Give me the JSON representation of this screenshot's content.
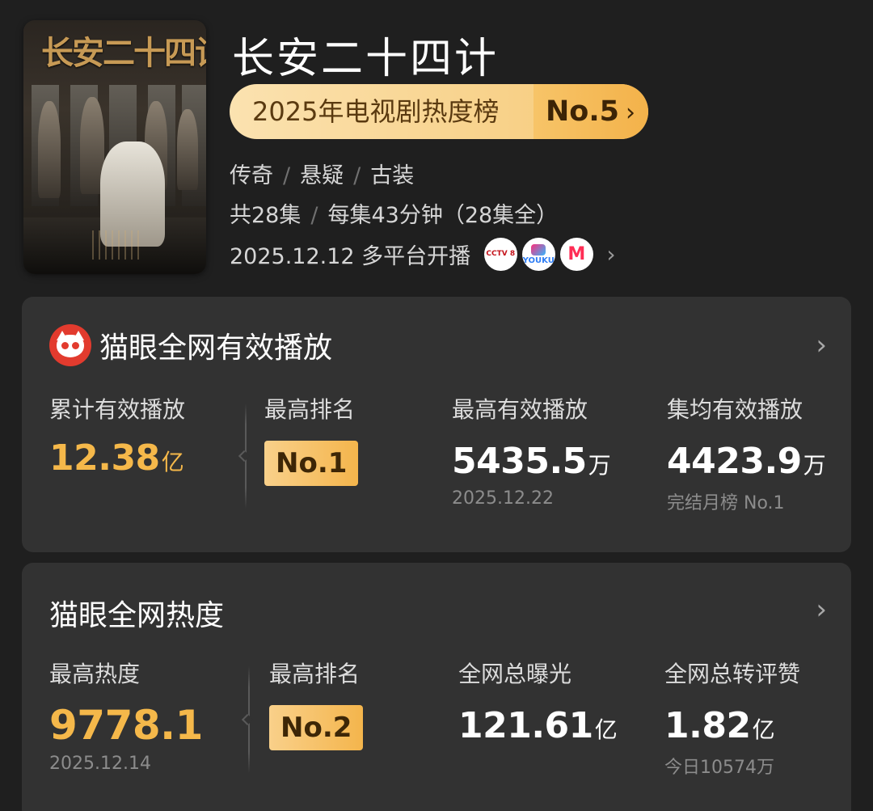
{
  "show": {
    "poster_title": "长安二十四计",
    "title": "长安二十四计",
    "rank_label": "2025年电视剧热度榜",
    "rank_no": "No.5",
    "genres": [
      "传奇",
      "悬疑",
      "古装"
    ],
    "episodes": "共28集",
    "episode_length": "每集43分钟（28集全）",
    "premiere": "2025.12.12 多平台开播",
    "platforms": [
      {
        "name": "cctv-8",
        "label": "CCTV 8"
      },
      {
        "name": "youku",
        "label": "YOUKU"
      },
      {
        "name": "mgtv",
        "label": "M"
      }
    ]
  },
  "playback": {
    "title": "猫眼全网有效播放",
    "total": {
      "label": "累计有效播放",
      "value": "12.38",
      "unit": "亿"
    },
    "rank": {
      "label": "最高排名",
      "value": "No.1"
    },
    "peak": {
      "label": "最高有效播放",
      "value": "5435.5",
      "unit": "万",
      "date": "2025.12.22"
    },
    "avg": {
      "label": "集均有效播放",
      "value": "4423.9",
      "unit": "万",
      "note": "完结月榜 No.1"
    }
  },
  "heat": {
    "title": "猫眼全网热度",
    "peak": {
      "label": "最高热度",
      "value": "9778.1",
      "date": "2025.12.14"
    },
    "rank": {
      "label": "最高排名",
      "value": "No.2"
    },
    "exposure": {
      "label": "全网总曝光",
      "value": "121.61",
      "unit": "亿"
    },
    "engagement": {
      "label": "全网总转评赞",
      "value": "1.82",
      "unit": "亿",
      "note": "今日10574万"
    }
  },
  "colors": {
    "accent": "#f5b84a",
    "background": "#1f1f1f",
    "card": "#323232",
    "maoyan_red": "#e23b2e"
  },
  "icons": {
    "chevron": "chevron-right-icon",
    "maoyan": "maoyan-cat-logo-icon"
  }
}
